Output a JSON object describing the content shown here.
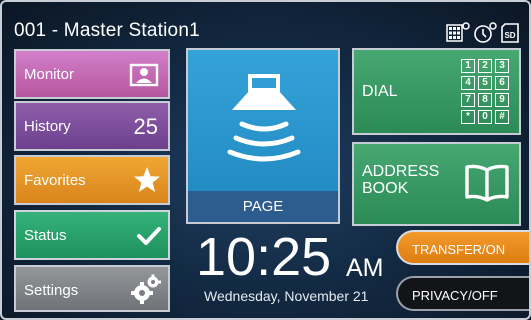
{
  "header": {
    "title": "001 - Master Station1"
  },
  "header_icons": [
    "keypad-settings-icon",
    "timer-icon",
    "sd-card-icon"
  ],
  "sidebar": {
    "items": [
      {
        "label": "Monitor",
        "icon": "person-icon",
        "color": "#c76bb6"
      },
      {
        "label": "History",
        "count": "25",
        "color": "#7d4e9c"
      },
      {
        "label": "Favorites",
        "icon": "star-icon",
        "color": "#e99526"
      },
      {
        "label": "Status",
        "icon": "check-icon",
        "color": "#28a46c"
      },
      {
        "label": "Settings",
        "icon": "gears-icon",
        "color": "#85878b"
      }
    ]
  },
  "main": {
    "page": {
      "label": "PAGE",
      "icon": "speaker-broadcast-icon",
      "color": "#2b95cf"
    },
    "dial": {
      "label": "DIAL",
      "icon": "keypad-icon",
      "keys": [
        "1",
        "2",
        "3",
        "4",
        "5",
        "6",
        "7",
        "8",
        "9",
        "*",
        "0",
        "#"
      ],
      "color": "#3c9a66"
    },
    "address_book": {
      "label_line1": "ADDRESS",
      "label_line2": "BOOK",
      "icon": "book-icon",
      "color": "#3c9a66"
    }
  },
  "clock": {
    "time": "10:25",
    "ampm": "AM",
    "date": "Wednesday, November 21"
  },
  "toggles": {
    "transfer": {
      "label": "TRANSFER/ON",
      "color": "#ee8f20"
    },
    "privacy": {
      "label": "PRIVACY/OFF",
      "color": "#121418"
    }
  }
}
